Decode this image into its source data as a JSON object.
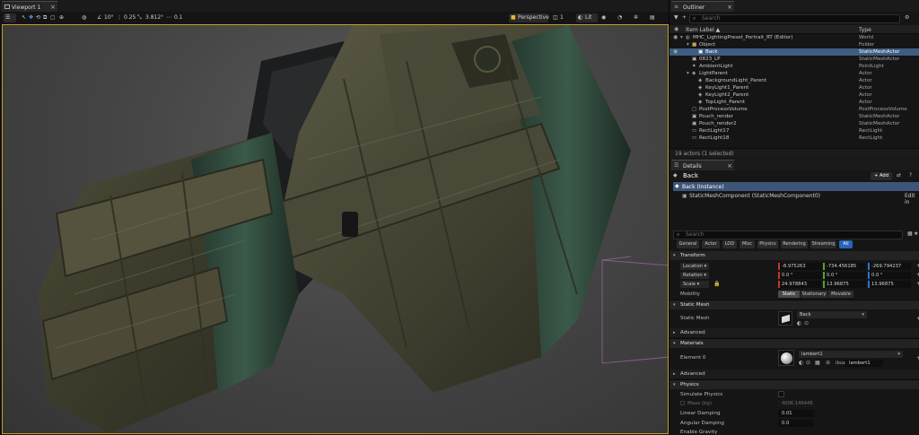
{
  "viewport": {
    "tab": "Viewport 1",
    "toolbar": {
      "angle": "10°",
      "scale_snap": "0.25",
      "scale": "3.812°",
      "speed": "0.1",
      "perspective": "Perspective",
      "view_mode": "Lit",
      "num": "1"
    }
  },
  "outliner": {
    "tab": "Outliner",
    "search_placeholder": "Search",
    "col_label": "Item Label ▲",
    "col_type": "Type",
    "rows": [
      {
        "label": "MHC_LightingPreset_Portrait_RT (Editor)",
        "type": "World",
        "depth": 0,
        "icon": "world-icon",
        "arrow": "▾"
      },
      {
        "label": "Object",
        "type": "Folder",
        "depth": 1,
        "icon": "folder-icon",
        "arrow": "▾"
      },
      {
        "label": "Back",
        "type": "StaticMeshActor",
        "depth": 2,
        "icon": "static-mesh-icon",
        "arrow": "",
        "selected": true
      },
      {
        "label": "0823_LP",
        "type": "StaticMeshActor",
        "depth": 1,
        "icon": "static-mesh-icon",
        "arrow": ""
      },
      {
        "label": "AmbientLight",
        "type": "PointLight",
        "depth": 1,
        "icon": "point-light-icon",
        "arrow": ""
      },
      {
        "label": "LightParent",
        "type": "Actor",
        "depth": 1,
        "icon": "actor-icon",
        "arrow": "▾"
      },
      {
        "label": "BackgroundLight_Parent",
        "type": "Actor",
        "depth": 2,
        "icon": "actor-icon",
        "arrow": ""
      },
      {
        "label": "KeyLight1_Parent",
        "type": "Actor",
        "depth": 2,
        "icon": "actor-icon",
        "arrow": ""
      },
      {
        "label": "KeyLight2_Parent",
        "type": "Actor",
        "depth": 2,
        "icon": "actor-icon",
        "arrow": ""
      },
      {
        "label": "TopLight_Parent",
        "type": "Actor",
        "depth": 2,
        "icon": "actor-icon",
        "arrow": ""
      },
      {
        "label": "PostProcessVolume",
        "type": "PostProcessVolume",
        "depth": 1,
        "icon": "volume-icon",
        "arrow": ""
      },
      {
        "label": "Pouch_render",
        "type": "StaticMeshActor",
        "depth": 1,
        "icon": "static-mesh-icon",
        "arrow": ""
      },
      {
        "label": "Pouch_render2",
        "type": "StaticMeshActor",
        "depth": 1,
        "icon": "static-mesh-icon",
        "arrow": ""
      },
      {
        "label": "RectLight17",
        "type": "RectLight",
        "depth": 1,
        "icon": "rect-light-icon",
        "arrow": ""
      },
      {
        "label": "RectLight18",
        "type": "RectLight",
        "depth": 1,
        "icon": "rect-light-icon",
        "arrow": ""
      }
    ],
    "status": "19 actors (1 selected)"
  },
  "details": {
    "tab": "Details",
    "title": "Back",
    "add_label": "+ Add",
    "instance": "Back (Instance)",
    "component": "StaticMeshComponent (StaticMeshComponent0)",
    "edit_in": "Edit in",
    "search_placeholder": "Search",
    "filters": [
      "General",
      "Actor",
      "LOD",
      "Misc",
      "Physics",
      "Rendering",
      "Streaming",
      "All"
    ],
    "active_filter": "All",
    "transform": {
      "section": "Transform",
      "location_label": "Location",
      "rotation_label": "Rotation",
      "scale_label": "Scale",
      "mobility_label": "Mobility",
      "location": [
        "-8.975263",
        "-734.456185",
        "-269.794237"
      ],
      "rotation": [
        "0.0 °",
        "0.0 °",
        "0.0 °"
      ],
      "scale": [
        "24.978843",
        "13.96875",
        "13.96875"
      ],
      "mobility": [
        "Static",
        "Stationary",
        "Movable"
      ],
      "mobility_selected": "Static"
    },
    "static_mesh": {
      "section": "Static Mesh",
      "label": "Static Mesh",
      "value": "Back"
    },
    "advanced1": "Advanced",
    "materials": {
      "section": "Materials",
      "element_label": "Element 0",
      "value": "lambert1",
      "source_prefix": "ibus",
      "source_value": "lambert1"
    },
    "advanced2": "Advanced",
    "physics": {
      "section": "Physics",
      "simulate_label": "Simulate Physics",
      "mass_label": "Mass (kg)",
      "mass_value": "4006.146446",
      "linear_label": "Linear Damping",
      "linear_value": "0.01",
      "angular_label": "Angular Damping",
      "angular_value": "0.0",
      "gravity_label": "Enable Gravity"
    }
  },
  "colors": {
    "selection": "#3f5d82",
    "accent": "#2a63b8",
    "viewport_border": "#c89a2a",
    "x_axis": "#c0392b",
    "y_axis": "#5aa02c",
    "z_axis": "#2f6fd1"
  }
}
